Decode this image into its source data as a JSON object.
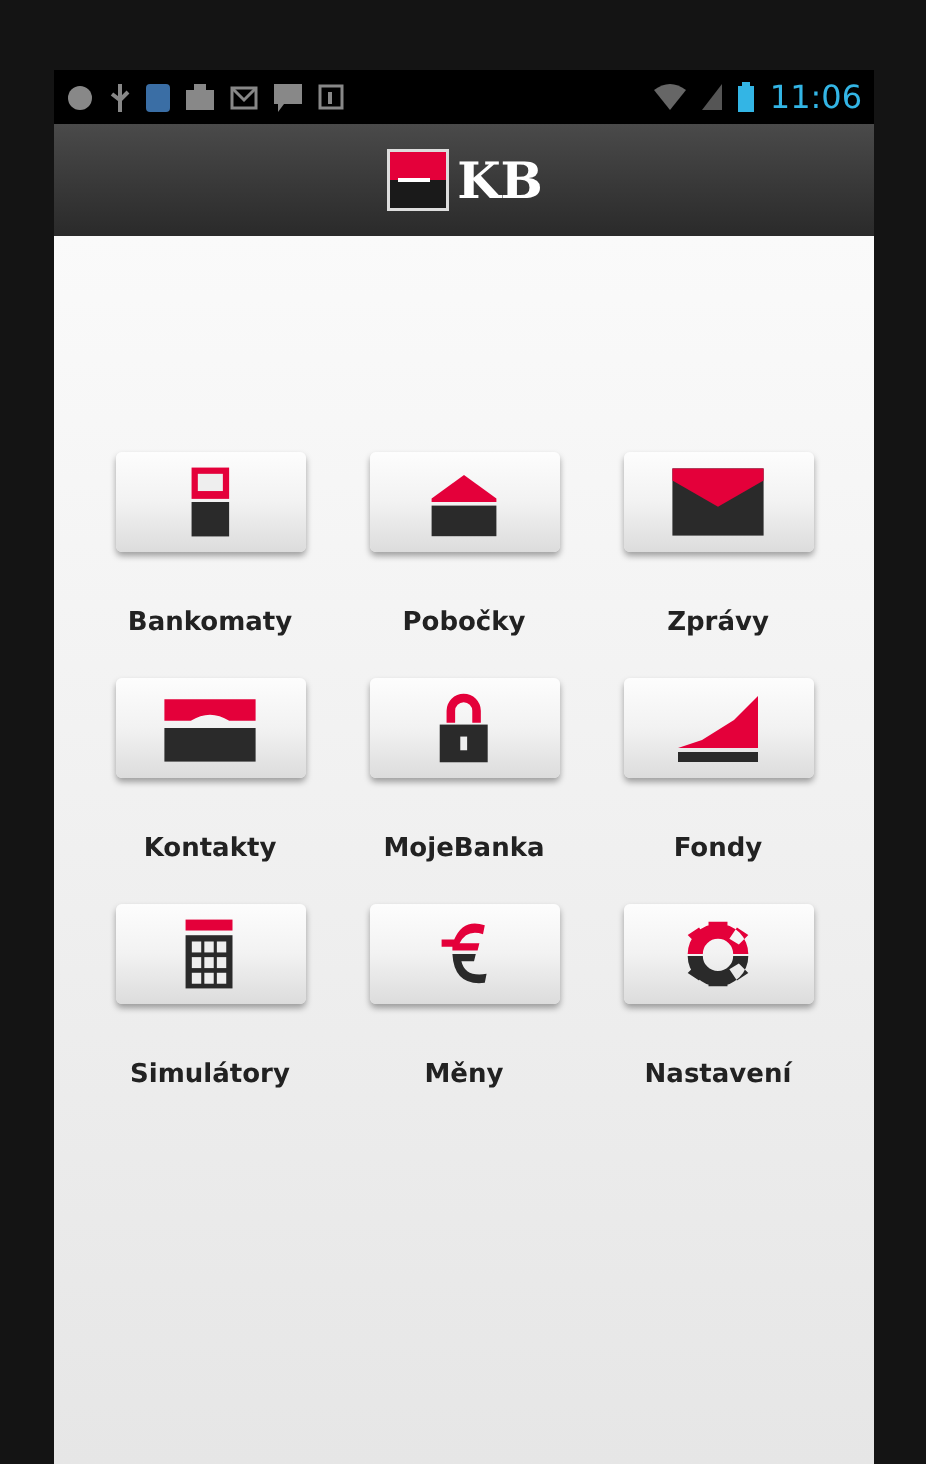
{
  "status_bar": {
    "time": "11:06"
  },
  "header": {
    "logo_text": "KB"
  },
  "tiles": [
    {
      "kind": "atm",
      "label": "Bankomaty"
    },
    {
      "kind": "branch",
      "label": "Pobočky"
    },
    {
      "kind": "mail",
      "label": "Zprávy"
    },
    {
      "kind": "contacts",
      "label": "Kontakty"
    },
    {
      "kind": "lock",
      "label": "MojeBanka"
    },
    {
      "kind": "chart",
      "label": "Fondy"
    },
    {
      "kind": "calculator",
      "label": "Simulátory"
    },
    {
      "kind": "euro",
      "label": "Měny"
    },
    {
      "kind": "gear",
      "label": "Nastavení"
    }
  ]
}
